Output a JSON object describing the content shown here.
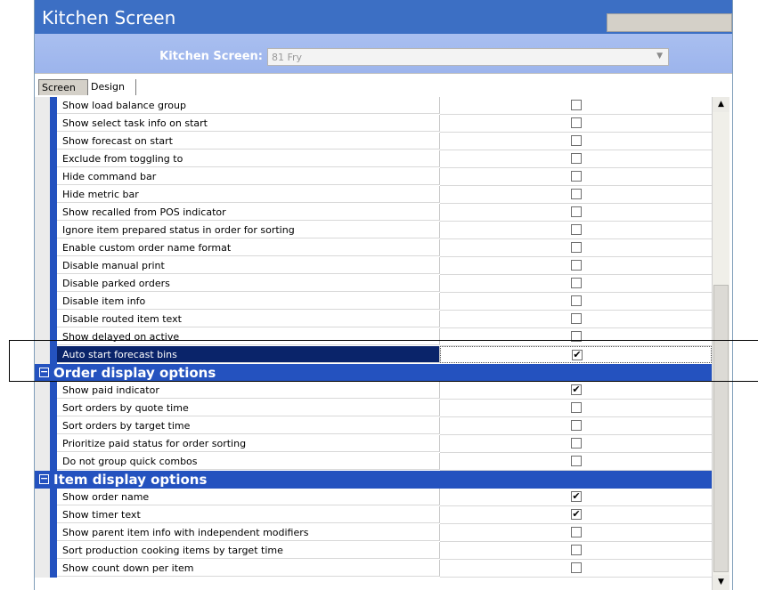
{
  "window": {
    "title": "Kitchen Screen"
  },
  "selector": {
    "label": "Kitchen Screen:",
    "value": "81 Fry"
  },
  "tabs": [
    {
      "label": "Screen",
      "active": true
    },
    {
      "label": "Design",
      "active": false
    }
  ],
  "rows_top": [
    {
      "label": "Show load balance group",
      "checked": false
    },
    {
      "label": "Show select task info on start",
      "checked": false
    },
    {
      "label": "Show forecast on start",
      "checked": false
    },
    {
      "label": "Exclude from toggling to",
      "checked": false
    },
    {
      "label": "Hide command bar",
      "checked": false
    },
    {
      "label": "Hide metric bar",
      "checked": false
    },
    {
      "label": "Show recalled from POS indicator",
      "checked": false
    },
    {
      "label": "Ignore item prepared status in order for sorting",
      "checked": false
    },
    {
      "label": "Enable custom order name format",
      "checked": false
    },
    {
      "label": "Disable manual print",
      "checked": false
    },
    {
      "label": "Disable parked orders",
      "checked": false
    },
    {
      "label": "Disable item info",
      "checked": false
    },
    {
      "label": "Disable routed item text",
      "checked": false
    },
    {
      "label": "Show delayed on active",
      "checked": false
    },
    {
      "label": "Auto start forecast bins",
      "checked": true,
      "selected": true
    }
  ],
  "group_order": {
    "title": "Order display options",
    "rows": [
      {
        "label": "Show paid indicator",
        "checked": true
      },
      {
        "label": "Sort orders by quote time",
        "checked": false
      },
      {
        "label": "Sort orders by target time",
        "checked": false
      },
      {
        "label": "Prioritize paid status for order sorting",
        "checked": false
      },
      {
        "label": "Do not group quick combos",
        "checked": false
      }
    ]
  },
  "group_item": {
    "title": "Item display options",
    "rows": [
      {
        "label": "Show order name",
        "checked": true
      },
      {
        "label": "Show timer text",
        "checked": true
      },
      {
        "label": "Show parent item info with independent modifiers",
        "checked": false
      },
      {
        "label": "Sort production cooking items by target time",
        "checked": false
      },
      {
        "label": "Show count down per item",
        "checked": false
      }
    ]
  },
  "colors": {
    "titlebar": "#3c6fc4",
    "group": "#2452bf",
    "selected": "#0a246a"
  }
}
